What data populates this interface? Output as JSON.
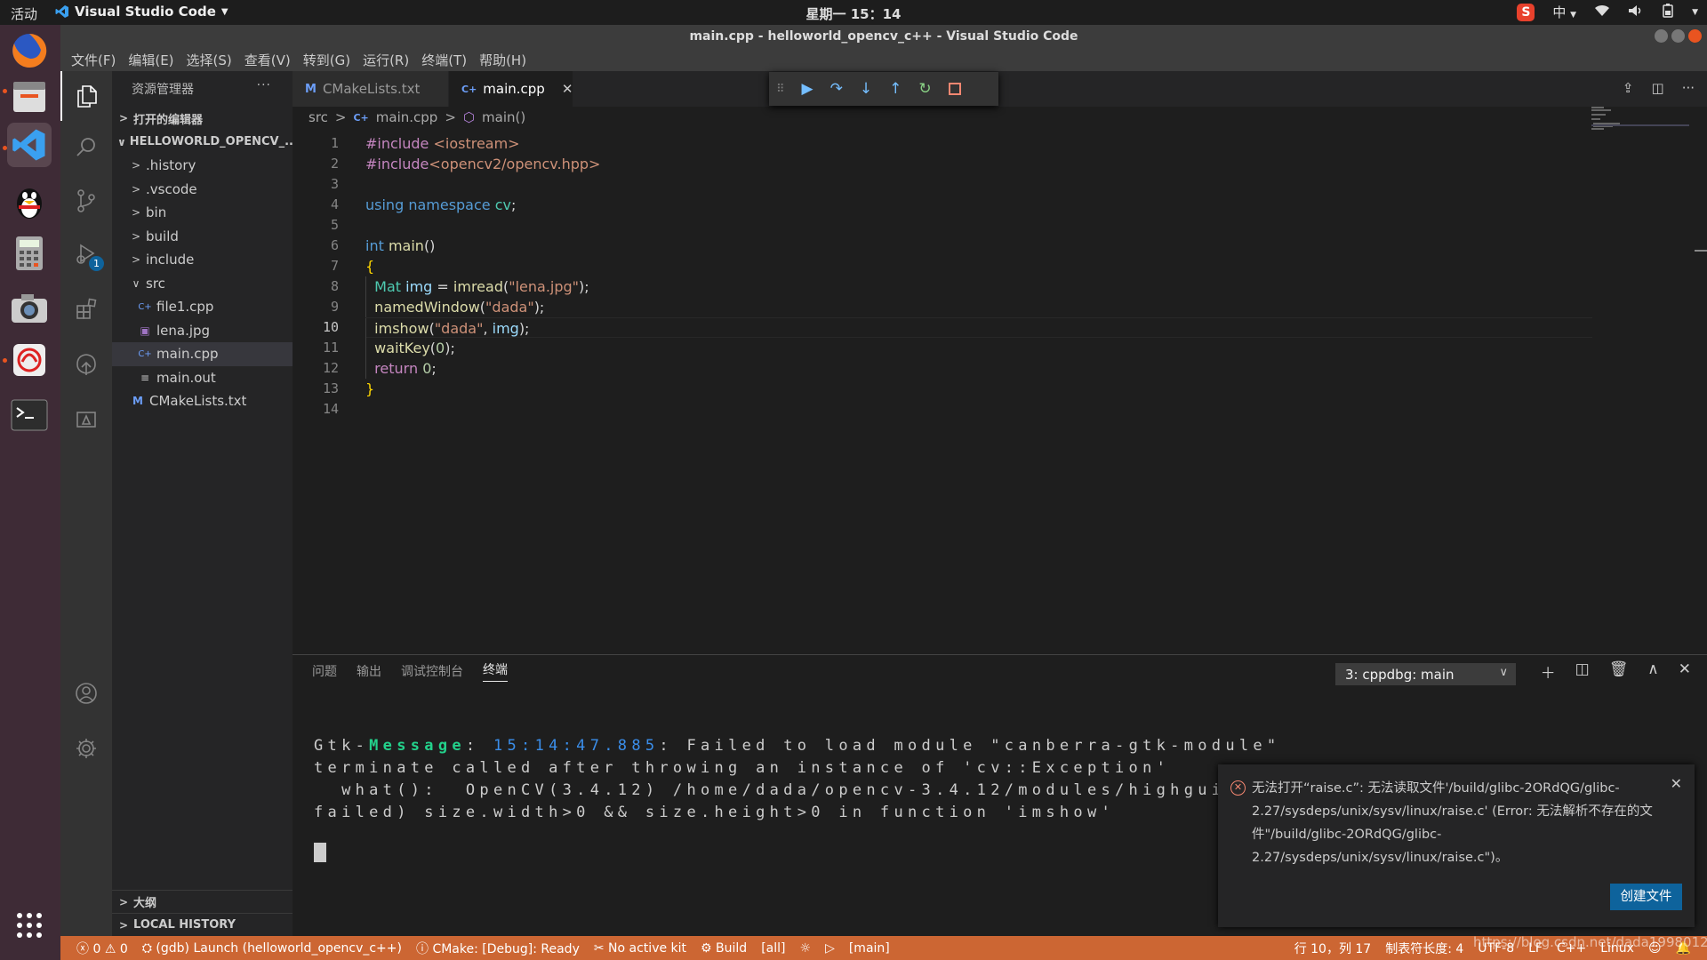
{
  "topbar": {
    "activities": "活动",
    "app_name": "Visual Studio Code",
    "clock": "星期一 15：14",
    "ime": "中"
  },
  "window": {
    "title": "main.cpp - helloworld_opencv_c++ - Visual Studio Code"
  },
  "menu": [
    "文件(F)",
    "编辑(E)",
    "选择(S)",
    "查看(V)",
    "转到(G)",
    "运行(R)",
    "终端(T)",
    "帮助(H)"
  ],
  "activity_badge": "1",
  "sidebar": {
    "header": "资源管理器",
    "open_editors": "打开的编辑器",
    "workspace": "HELLOWORLD_OPENCV_...",
    "tree": [
      {
        "label": ".history",
        "kind": "folder",
        "depth": 1,
        "open": false
      },
      {
        "label": ".vscode",
        "kind": "folder",
        "depth": 1,
        "open": false
      },
      {
        "label": "bin",
        "kind": "folder",
        "depth": 1,
        "open": false
      },
      {
        "label": "build",
        "kind": "folder",
        "depth": 1,
        "open": false
      },
      {
        "label": "include",
        "kind": "folder",
        "depth": 1,
        "open": false
      },
      {
        "label": "src",
        "kind": "folder",
        "depth": 1,
        "open": true
      },
      {
        "label": "file1.cpp",
        "kind": "cpp",
        "depth": 2
      },
      {
        "label": "lena.jpg",
        "kind": "image",
        "depth": 2
      },
      {
        "label": "main.cpp",
        "kind": "cpp",
        "depth": 2,
        "selected": true
      },
      {
        "label": "main.out",
        "kind": "text",
        "depth": 2
      },
      {
        "label": "CMakeLists.txt",
        "kind": "cmake",
        "depth": 1
      }
    ],
    "outline": "大纲",
    "local_history": "LOCAL HISTORY"
  },
  "tabs": [
    {
      "label": "CMakeLists.txt",
      "icon": "M",
      "active": false
    },
    {
      "label": "main.cpp",
      "icon": "C+",
      "active": true
    }
  ],
  "breadcrumb": {
    "folder": "src",
    "file": "main.cpp",
    "symbol": "main()"
  },
  "code": {
    "current_line": 10,
    "lines": [
      [
        {
          "t": "#include ",
          "c": "pp"
        },
        {
          "t": "<iostream>",
          "c": "st"
        }
      ],
      [
        {
          "t": "#include",
          "c": "pp"
        },
        {
          "t": "<opencv2/opencv.hpp>",
          "c": "st"
        }
      ],
      [],
      [
        {
          "t": "using ",
          "c": "kw"
        },
        {
          "t": "namespace ",
          "c": "kw"
        },
        {
          "t": "cv",
          "c": "ns"
        },
        {
          "t": ";",
          "c": "pl"
        }
      ],
      [],
      [
        {
          "t": "int ",
          "c": "kw"
        },
        {
          "t": "main",
          "c": "fn"
        },
        {
          "t": "()",
          "c": "pl"
        }
      ],
      [
        {
          "t": "{",
          "c": "br"
        }
      ],
      [
        {
          "t": "  ",
          "c": "pl"
        },
        {
          "t": "Mat ",
          "c": "ty"
        },
        {
          "t": "img",
          "c": "va"
        },
        {
          "t": " = ",
          "c": "pl"
        },
        {
          "t": "imread",
          "c": "fn"
        },
        {
          "t": "(",
          "c": "pl"
        },
        {
          "t": "\"lena.jpg\"",
          "c": "st"
        },
        {
          "t": ");",
          "c": "pl"
        }
      ],
      [
        {
          "t": "  ",
          "c": "pl"
        },
        {
          "t": "namedWindow",
          "c": "fn"
        },
        {
          "t": "(",
          "c": "pl"
        },
        {
          "t": "\"dada\"",
          "c": "st"
        },
        {
          "t": ");",
          "c": "pl"
        }
      ],
      [
        {
          "t": "  ",
          "c": "pl"
        },
        {
          "t": "imshow",
          "c": "fn"
        },
        {
          "t": "(",
          "c": "pl"
        },
        {
          "t": "\"dada\"",
          "c": "st"
        },
        {
          "t": ", ",
          "c": "pl"
        },
        {
          "t": "img",
          "c": "va"
        },
        {
          "t": ");",
          "c": "pl"
        }
      ],
      [
        {
          "t": "  ",
          "c": "pl"
        },
        {
          "t": "waitKey",
          "c": "fn"
        },
        {
          "t": "(",
          "c": "pl"
        },
        {
          "t": "0",
          "c": "nu"
        },
        {
          "t": ");",
          "c": "pl"
        }
      ],
      [
        {
          "t": "  ",
          "c": "pl"
        },
        {
          "t": "return ",
          "c": "pp"
        },
        {
          "t": "0",
          "c": "nu"
        },
        {
          "t": ";",
          "c": "pl"
        }
      ],
      [
        {
          "t": "}",
          "c": "br"
        }
      ],
      []
    ]
  },
  "panel": {
    "tabs": [
      "问题",
      "输出",
      "调试控制台",
      "终端"
    ],
    "active_tab": "终端",
    "terminal_select": "3: cppdbg: main",
    "terminal": {
      "line1_prefix": "Gtk-",
      "line1_msg": "Message",
      "line1_sep": ": ",
      "line1_time": "15:14:47.885",
      "line1_rest": ": Failed to load module \"canberra-gtk-module\"",
      "line2": "terminate called after throwing an instance of 'cv::Exception'",
      "line3": "  what():  OpenCV(3.4.12) /home/dada/opencv-3.4.12/modules/highgui/src/wi",
      "line4": "failed) size.width>0 && size.height>0 in function 'imshow'"
    }
  },
  "notification": {
    "message": "无法打开“raise.c”: 无法读取文件'/build/glibc-2ORdQG/glibc-2.27/sysdeps/unix/sysv/linux/raise.c' (Error: 无法解析不存在的文件\"/build/glibc-2ORdQG/glibc-2.27/sysdeps/unix/sysv/linux/raise.c\")。",
    "button": "创建文件"
  },
  "statusbar": {
    "errors": "0",
    "warnings": "0",
    "launch": "(gdb) Launch (helloworld_opencv_c++)",
    "cmake": "CMake: [Debug]: Ready",
    "kit": "No active kit",
    "build": "Build",
    "target": "[all]",
    "main": "[main]",
    "position": "行 10，列 17",
    "tab_size": "制表符长度: 4",
    "encoding": "UTF-8",
    "eol": "LF",
    "language": "C++",
    "os": "Linux",
    "color": "#cc6633"
  },
  "watermark": "https://blog.csdn.net/dada19980122"
}
